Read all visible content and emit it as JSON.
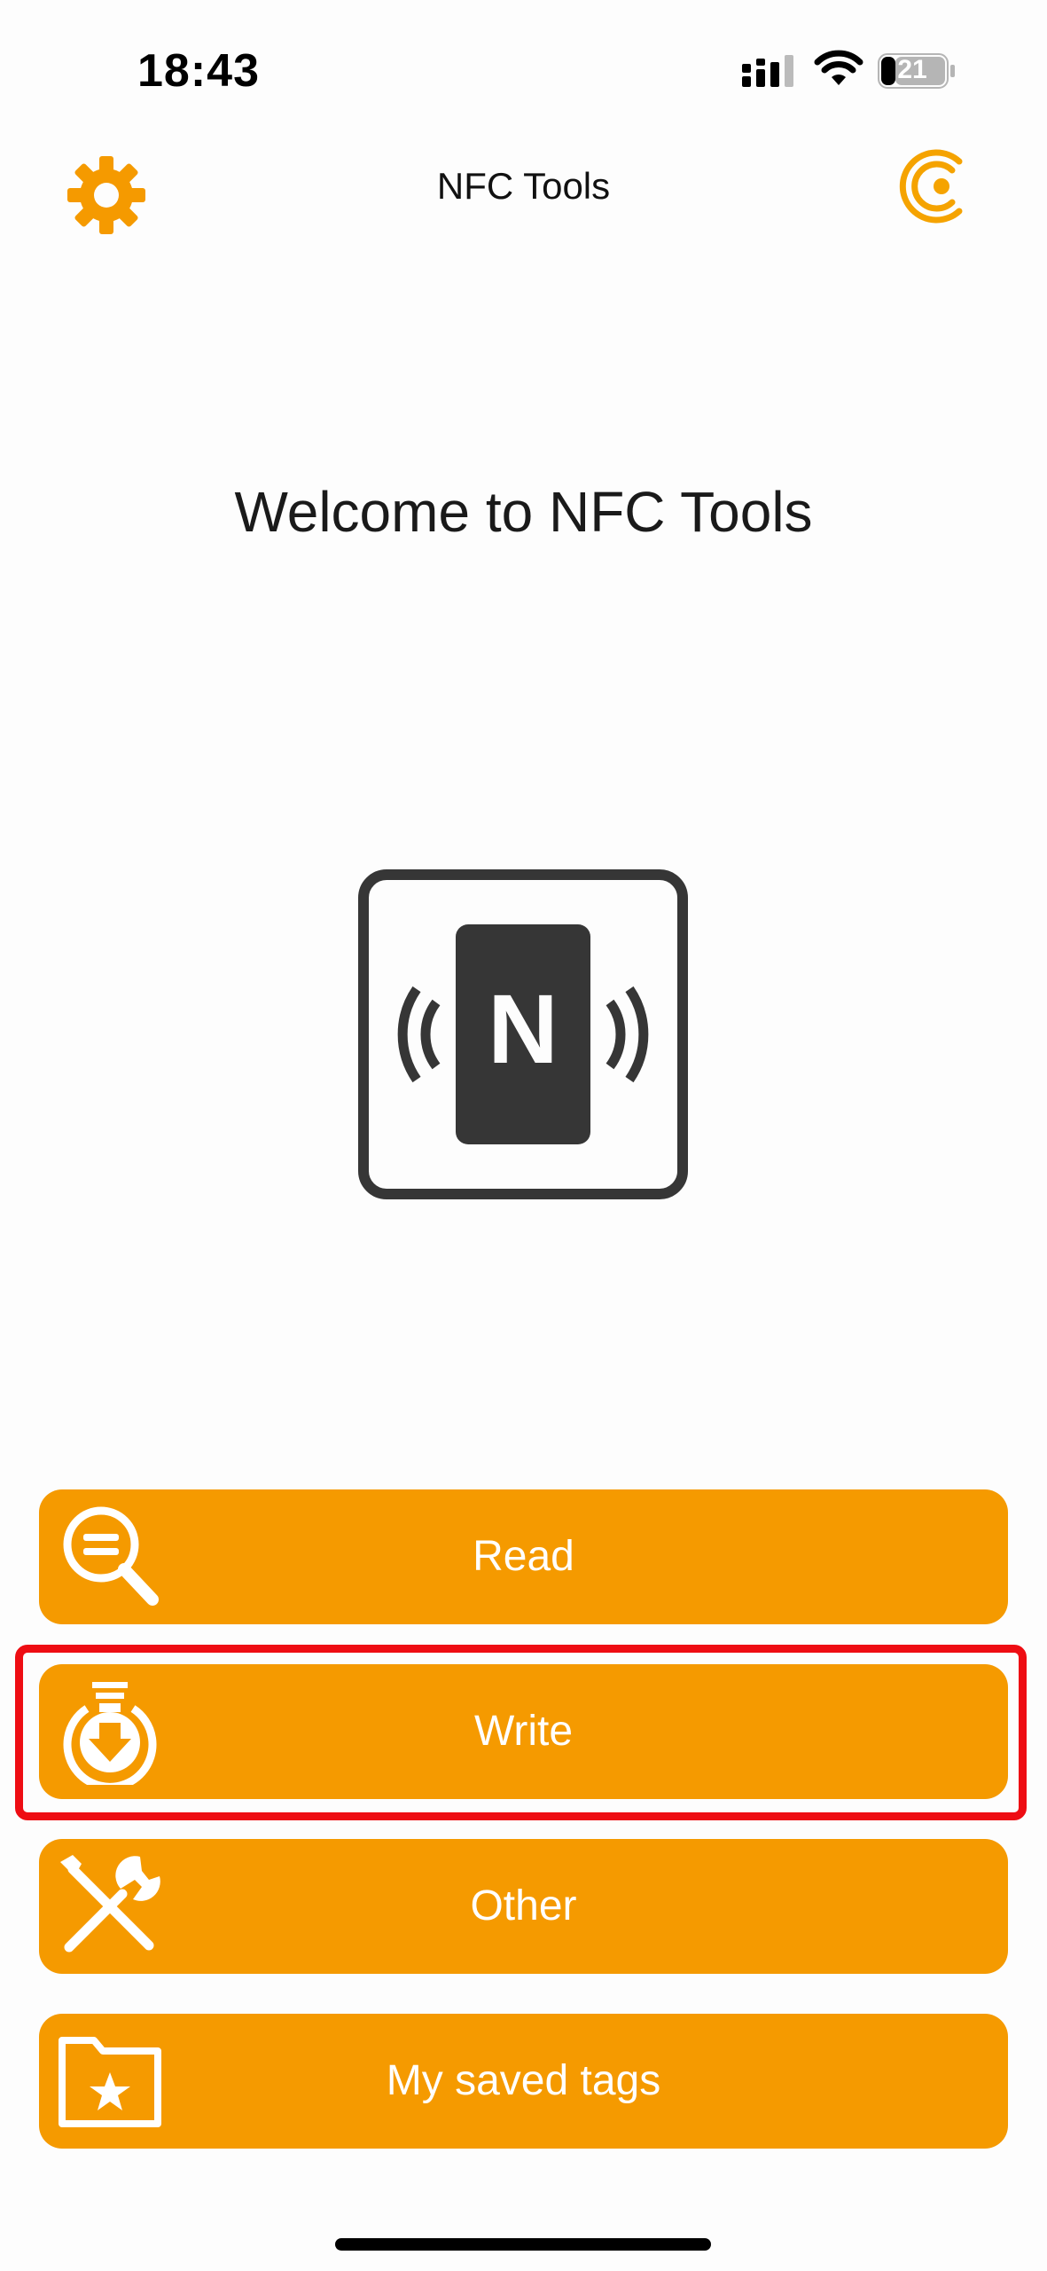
{
  "status_bar": {
    "time": "18:43",
    "battery": "21",
    "icons": [
      "cellular-signal-icon",
      "wifi-icon",
      "battery-icon"
    ]
  },
  "nav": {
    "title": "NFC Tools",
    "left_icon": "gear-icon",
    "right_icon": "pro-c-logo-icon"
  },
  "welcome_text": "Welcome to NFC Tools",
  "logo": {
    "letter": "N",
    "icon": "nfc-logo-icon"
  },
  "menu": [
    {
      "label": "Read",
      "icon": "read-magnifier-icon"
    },
    {
      "label": "Write",
      "icon": "write-download-icon"
    },
    {
      "label": "Other",
      "icon": "tools-wrench-screwdriver-icon"
    },
    {
      "label": "My saved tags",
      "icon": "saved-folder-star-icon"
    }
  ],
  "colors": {
    "accent": "#f59a00",
    "highlight": "#ee0d13",
    "logo_dark": "#363636",
    "background": "#fdfdfd"
  }
}
